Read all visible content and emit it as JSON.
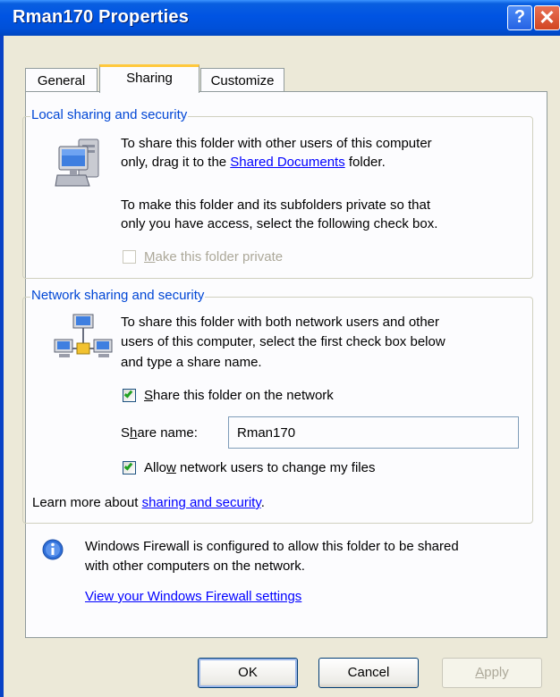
{
  "window": {
    "title": "Rman170 Properties",
    "help_label": "?",
    "close_label": "✕"
  },
  "tabs": [
    {
      "label": "General"
    },
    {
      "label": "Sharing"
    },
    {
      "label": "Customize"
    }
  ],
  "local": {
    "group_title": "Local sharing and security",
    "text1_a": "To share this folder with other users of this computer",
    "text1_b": "only, drag it to the",
    "shared_docs_link": "Shared Documents",
    "text1_c": "folder.",
    "text2_a": "To make this folder and its subfolders private so that",
    "text2_b": "only you have access, select the following check box.",
    "private_label_key": "M",
    "private_label_rest": "ake this folder private",
    "private_checked": false
  },
  "network": {
    "group_title": "Network sharing and security",
    "text_a": "To share this folder with both network users and other",
    "text_b": "users of this computer, select the first check box below",
    "text_c": "and type a share name.",
    "share_label_key": "S",
    "share_label_rest": "hare this folder on the network",
    "share_checked": true,
    "share_name_label_a": "S",
    "share_name_label_key": "h",
    "share_name_label_b": "are name:",
    "share_name_value": "Rman170",
    "allow_label_a": "Allo",
    "allow_label_key": "w",
    "allow_label_b": " network users to change my files",
    "allow_checked": true,
    "learn_more_prefix": "Learn more about",
    "learn_more_link": "sharing and security",
    "learn_more_suffix": "."
  },
  "firewall": {
    "line1": "Windows Firewall is configured to allow this folder to be shared",
    "line2": "with other computers on the network.",
    "settings_link": "View your Windows Firewall settings"
  },
  "buttons": {
    "ok": "OK",
    "cancel": "Cancel",
    "apply_key": "A",
    "apply_rest": "pply"
  }
}
